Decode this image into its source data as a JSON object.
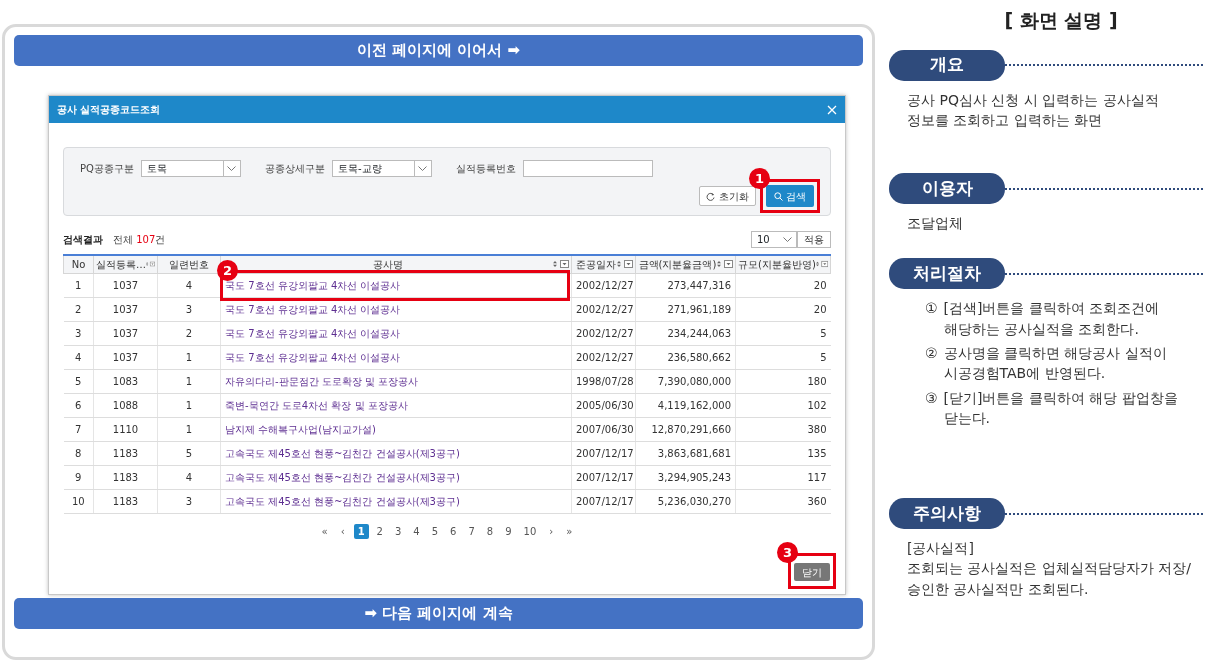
{
  "banner_top": "이전 페이지에 이어서 ➡",
  "dialog": {
    "title": "공사 실적공종코드조회",
    "filters": [
      {
        "label": "PQ공종구분",
        "kind": "select",
        "value": "토목"
      },
      {
        "label": "공종상세구분",
        "kind": "select",
        "value": "토목-교량"
      },
      {
        "label": "실적등록번호",
        "kind": "input"
      }
    ],
    "reset_button": "초기화",
    "search_button": "검색",
    "result_label": "검색결과",
    "total_prefix": "전체",
    "total_count": "107",
    "total_suffix": "건",
    "page_size": "10",
    "apply_button": "적용",
    "columns": [
      {
        "label": "No",
        "sortable": false
      },
      {
        "label": "실적등록…",
        "sortable": true
      },
      {
        "label": "일련번호",
        "sortable": false
      },
      {
        "label": "공사명",
        "sortable": true
      },
      {
        "label": "준공일자",
        "sortable": true
      },
      {
        "label": "금액(지분율금액)",
        "sortable": true
      },
      {
        "label": "규모(지분율반영)",
        "sortable": true
      }
    ],
    "rows": [
      [
        "1",
        "1037",
        "4",
        "국도 7호선 유강외팔교 4차선 이설공사",
        "2002/12/27",
        "273,447,316",
        "20"
      ],
      [
        "2",
        "1037",
        "3",
        "국도 7호선 유강외팔교 4차선 이설공사",
        "2002/12/27",
        "271,961,189",
        "20"
      ],
      [
        "3",
        "1037",
        "2",
        "국도 7호선 유강외팔교 4차선 이설공사",
        "2002/12/27",
        "234,244,063",
        "5"
      ],
      [
        "4",
        "1037",
        "1",
        "국도 7호선 유강외팔교 4차선 이설공사",
        "2002/12/27",
        "236,580,662",
        "5"
      ],
      [
        "5",
        "1083",
        "1",
        "자유의다리-판문점간 도로확장 및 포장공사",
        "1998/07/28",
        "7,390,080,000",
        "180"
      ],
      [
        "6",
        "1088",
        "1",
        "죽변-묵연간 도로4차선 확장 및 포장공사",
        "2005/06/30",
        "4,119,162,000",
        "102"
      ],
      [
        "7",
        "1110",
        "1",
        "남지제 수해복구사업(남지교가설)",
        "2007/06/30",
        "12,870,291,660",
        "380"
      ],
      [
        "8",
        "1183",
        "5",
        "고속국도 제45호선 현풍~김천간 건설공사(제3공구)",
        "2007/12/17",
        "3,863,681,681",
        "135"
      ],
      [
        "9",
        "1183",
        "4",
        "고속국도 제45호선 현풍~김천간 건설공사(제3공구)",
        "2007/12/17",
        "3,294,905,243",
        "117"
      ],
      [
        "10",
        "1183",
        "3",
        "고속국도 제45호선 현풍~김천간 건설공사(제3공구)",
        "2007/12/17",
        "5,236,030,270",
        "360"
      ]
    ],
    "pager_first": "«",
    "pager_prev": "‹",
    "pages": [
      {
        "label": "1",
        "selected": true
      },
      {
        "label": "2",
        "selected": false
      },
      {
        "label": "3",
        "selected": false
      },
      {
        "label": "4",
        "selected": false
      },
      {
        "label": "5",
        "selected": false
      },
      {
        "label": "6",
        "selected": false
      },
      {
        "label": "7",
        "selected": false
      },
      {
        "label": "8",
        "selected": false
      },
      {
        "label": "9",
        "selected": false
      },
      {
        "label": "10",
        "selected": false
      }
    ],
    "pager_next": "›",
    "pager_last": "»",
    "close_button": "닫기"
  },
  "callouts": [
    {
      "number": "1"
    },
    {
      "number": "2"
    },
    {
      "number": "3"
    }
  ],
  "banner_bottom": "➡ 다음 페이지에 계속",
  "description": {
    "title": "[ 화면 설명 ]",
    "sections": [
      {
        "heading": "개요",
        "kind": "text",
        "lines": [
          "공사 PQ심사 신청 시 입력하는 공사실적 정보를 조회하고 입력하는 화면"
        ]
      },
      {
        "heading": "이용자",
        "kind": "text",
        "lines": [
          "조달업체"
        ]
      },
      {
        "heading": "처리절차",
        "kind": "steps",
        "steps": [
          {
            "mark": "①",
            "text": "[검색]버튼을 클릭하여 조회조건에 해당하는 공사실적을 조회한다."
          },
          {
            "mark": "②",
            "text": "공사명을 클릭하면 해당공사 실적이 시공경험TAB에 반영된다."
          },
          {
            "mark": "③",
            "text": "[닫기]버튼을 클릭하여 해당 팝업창을 닫는다."
          }
        ]
      },
      {
        "heading": "주의사항",
        "kind": "text",
        "lines": [
          "[공사실적]",
          "조회되는 공사실적은 업체실적담당자가 저장/승인한 공사실적만 조회된다."
        ]
      }
    ]
  }
}
